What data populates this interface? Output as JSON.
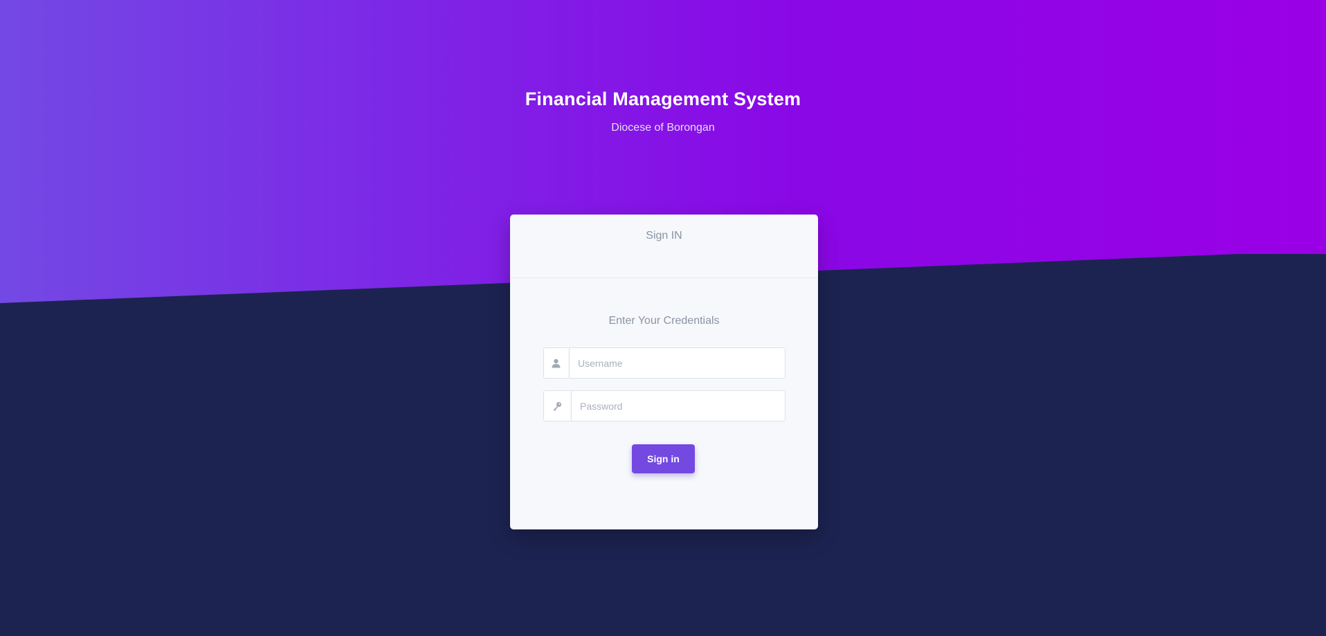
{
  "hero": {
    "title": "Financial Management System",
    "subtitle": "Diocese of Borongan"
  },
  "card": {
    "header_title": "Sign IN",
    "credentials_label": "Enter Your Credentials",
    "username": {
      "placeholder": "Username",
      "value": "",
      "icon": "user-icon"
    },
    "password": {
      "placeholder": "Password",
      "value": "",
      "icon": "key-icon"
    },
    "signin_label": "Sign in"
  },
  "colors": {
    "gradient_start": "#7349e4",
    "gradient_end": "#9a00e6",
    "background_dark": "#1c2350",
    "button": "#7349e2"
  }
}
